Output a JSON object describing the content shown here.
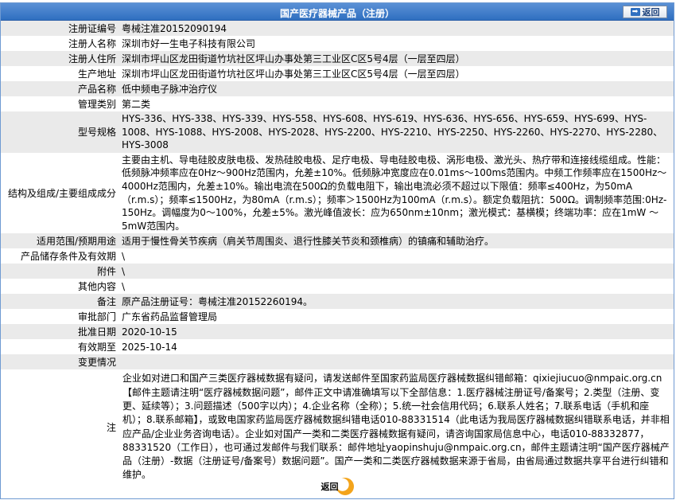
{
  "header": {
    "title": "国产医疗器械产品（注册）",
    "back_label": "返回"
  },
  "rows": [
    {
      "key": "注册证编号",
      "value": "粤械注准20152090194"
    },
    {
      "key": "注册人名称",
      "value": "深圳市好一生电子科技有限公司"
    },
    {
      "key": "注册人住所",
      "value": "深圳市坪山区龙田街道竹坑社区坪山办事处第三工业区C区5号4层（一层至四层）"
    },
    {
      "key": "生产地址",
      "value": "深圳市坪山区龙田街道竹坑社区坪山办事处第三工业区C区5号4层（一层至四层）"
    },
    {
      "key": "产品名称",
      "value": "低中频电子脉冲治疗仪"
    },
    {
      "key": "管理类别",
      "value": "第二类"
    },
    {
      "key": "型号规格",
      "value": "HYS-336、HYS-338、HYS-339、HYS-558、HYS-608、HYS-619、HYS-636、HYS-656、HYS-659、HYS-699、HYS-1008、HYS-1088、HYS-2008、HYS-2028、HYS-2200、HYS-2210、HYS-2250、HYS-2260、HYS-2270、HYS-2280、HYS-3008"
    },
    {
      "key": "结构及组成/主要组成成分",
      "value": "主要由主机、导电硅胶皮肤电极、发热硅胶电极、足疗电极、导电硅胶电极、涡形电极、激光头、热疗带和连接线缆组成。性能：低频脉冲频率应在0Hz～900Hz范围内，允差±10%。低频脉冲宽度应在0.01ms～100ms范围内。中频工作频率应在1500Hz～4000Hz范围内，允差±10%。输出电流在500Ω的负载电阻下，输出电流必须不超过以下限值：频率≤400Hz，为50mA（r.m.s）；频率≤1500Hz，为80mA（r.m.s）；频率＞1500Hz为100mA（r.m.s）。额定负载阻抗：500Ω。调制频率范围:0Hz-150Hz。调幅度为0～100%，允差±5%。激光峰值波长：应为650nm±10nm；激光模式：基横模；终端功率：应在1mW ～5mW范围内。"
    },
    {
      "key": "适用范围/预期用途",
      "value": "适用于慢性骨关节疾病（肩关节周围炎、退行性膝关节炎和颈椎病）的镇痛和辅助治疗。"
    },
    {
      "key": "产品储存条件及有效期",
      "value": "\\"
    },
    {
      "key": "附件",
      "value": "\\"
    },
    {
      "key": "其他内容",
      "value": "\\"
    },
    {
      "key": "备注",
      "value": "原产品注册证号：粤械注准20152260194。"
    },
    {
      "key": "审批部门",
      "value": "广东省药品监督管理局"
    },
    {
      "key": "批准日期",
      "value": "2020-10-15"
    },
    {
      "key": "有效期至",
      "value": "2025-10-14"
    },
    {
      "key": "变更情况",
      "value": ""
    }
  ],
  "note": {
    "key": "注",
    "value": "企业如对进口和国产三类医疗器械数据有疑问，请发送邮件至国家药监局医疗器械数据纠错邮箱：qixiejiucuo@nmpaic.org.cn【邮件主题请注明“医疗器械数据问题”，邮件正文中请准确填写以下全部信息：1.医疗器械注册证号/备案号；2.类型（注册、变更、延续等）；3.问题描述（500字以内）；4.企业名称（全称）；5.统一社会信用代码；6.联系人姓名；7.联系电话（手机和座机）；8.联系邮箱】，或致电国家药监局医疗器械数据纠错电话010-88331514（此电话为我局医疗器械数据纠错联系电话，并非相应产品/企业业务咨询电话）。企业如对国产一类和二类医疗器械数据有疑问，请咨询国家局信息中心，电话010-88332877，88331520（工作日），也可通过发邮件与我们联系：邮件地址yaopinshuju@nmpaic.org.cn，邮件主题请注明“国产医疗器械产品（注册）-数据（注册证号/备案号）数据问题”。国产一类和二类医疗器械数据来源于省局，由省局通过数据共享平台进行纠错和维护。"
  },
  "footer": {
    "back_label": "返回"
  }
}
